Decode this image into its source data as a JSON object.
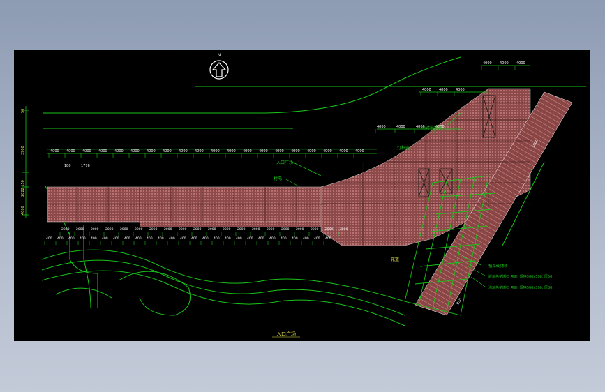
{
  "title_bottom": "入口广场",
  "north_symbol": "N",
  "labels": {
    "entrance_plaza": "入口广场",
    "village_power": "村电",
    "lamp_pole": "灯杆电",
    "cable_well": "无时电缆箱",
    "brick_path": "植草砖铺装",
    "note1": "嵌灰色花岗石 两面, 规格500x500, 厚50",
    "note2": "浅灰色花岗石 两面, 规格500x500, 厚30",
    "box_label": "花篮",
    "dim_v_1": "50",
    "dim_v_2": "3900",
    "dim_v_3": "2822 150",
    "dim_v_4": "4000",
    "dim_1776": "1776",
    "dim_180": "180",
    "dim_5000": "5000",
    "dim_950": "950"
  },
  "top_dims": [
    "4000",
    "4000",
    "4000",
    "4000",
    "4000",
    "4000",
    "4000",
    "4000",
    "4000",
    "4000",
    "4000",
    "4000",
    "4000",
    "4000",
    "4000",
    "4000",
    "4000",
    "4000",
    "4000",
    "4000"
  ],
  "upper_dims": [
    "4000",
    "4000",
    "4000",
    "4000"
  ],
  "top_right_dims": [
    "4000",
    "4000",
    "4000"
  ],
  "mid_dims": [
    "4000",
    "4000",
    "4000"
  ],
  "bottom_dims": [
    "2000",
    "2000",
    "2000",
    "2000",
    "2000",
    "2000",
    "2000",
    "2000",
    "2000",
    "2000",
    "2000",
    "2000",
    "2000",
    "2000",
    "2000",
    "2000",
    "2000",
    "2000",
    "2000",
    "2000"
  ],
  "low_dims": [
    "400",
    "400",
    "400",
    "400",
    "400",
    "400",
    "400",
    "400",
    "400",
    "400",
    "400",
    "400",
    "400",
    "400",
    "400",
    "400",
    "400",
    "400",
    "400",
    "400",
    "400",
    "400",
    "400",
    "400",
    "400",
    "400"
  ],
  "colors": {
    "background": "#000000",
    "paving": "#a05a5a",
    "line_green": "#19c419",
    "text_yellow": "#e8e84a",
    "white": "#ffffff"
  }
}
